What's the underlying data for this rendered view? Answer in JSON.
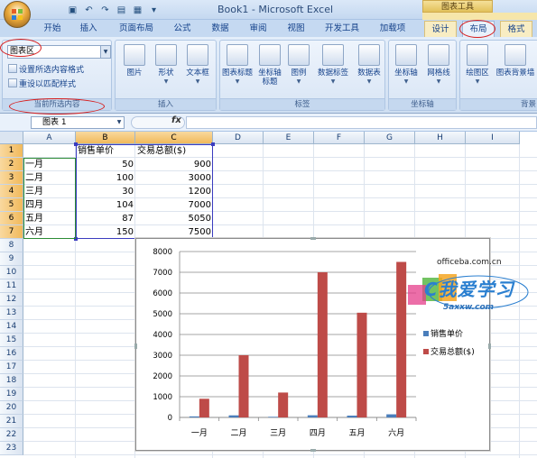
{
  "app": {
    "window_title": "Book1 - Microsoft Excel",
    "context_group": "图表工具"
  },
  "quick_access": {
    "icons": [
      "save-icon",
      "undo-icon",
      "redo-icon",
      "open-icon",
      "print-preview-icon",
      "customize-icon"
    ]
  },
  "tabs": [
    {
      "label": "开始"
    },
    {
      "label": "插入"
    },
    {
      "label": "页面布局"
    },
    {
      "label": "公式"
    },
    {
      "label": "数据"
    },
    {
      "label": "审阅"
    },
    {
      "label": "视图"
    },
    {
      "label": "开发工具"
    },
    {
      "label": "加载项"
    },
    {
      "label": "设计"
    },
    {
      "label": "布局"
    },
    {
      "label": "格式"
    }
  ],
  "active_tab": "布局",
  "ribbon": {
    "current_selection": {
      "combo_value": "图表区",
      "cmd_format": "设置所选内容格式",
      "cmd_reset": "重设以匹配样式",
      "label": "当前所选内容"
    },
    "insert_group": {
      "label": "插入",
      "buttons": [
        "图片",
        "形状",
        "文本框"
      ]
    },
    "labels_group": {
      "label": "标签",
      "buttons": [
        "图表标题",
        "坐标轴标题",
        "图例",
        "数据标签",
        "模拟运算表"
      ],
      "visible_labels": [
        "图表标题",
        "坐标轴\n标题",
        "图例",
        "数据标签",
        "数据表"
      ]
    },
    "axes_group": {
      "label": "坐标轴",
      "buttons": [
        "坐标轴",
        "网格线"
      ]
    },
    "background_group": {
      "label": "背景",
      "buttons": [
        "绘图区",
        "图表背景墙"
      ]
    }
  },
  "formula_bar": {
    "name_box": "图表 1",
    "fx": "fx",
    "formula": ""
  },
  "sheet": {
    "columns": [
      "A",
      "B",
      "C",
      "D",
      "E",
      "F",
      "G",
      "H",
      "I"
    ],
    "rows": [
      "1",
      "2",
      "3",
      "4",
      "5",
      "6",
      "7",
      "8",
      "9",
      "10",
      "11",
      "12",
      "13",
      "14",
      "15",
      "16",
      "17",
      "18",
      "19",
      "20",
      "21",
      "22",
      "23"
    ],
    "header": {
      "B": "销售单价",
      "C": "交易总额($)"
    },
    "data": [
      {
        "month": "一月",
        "price": "50",
        "total": "900"
      },
      {
        "month": "二月",
        "price": "100",
        "total": "3000"
      },
      {
        "month": "三月",
        "price": "30",
        "total": "1200"
      },
      {
        "month": "四月",
        "price": "104",
        "total": "7000"
      },
      {
        "month": "五月",
        "price": "87",
        "total": "5050"
      },
      {
        "month": "六月",
        "price": "150",
        "total": "7500"
      }
    ]
  },
  "chart_data": {
    "type": "bar",
    "categories": [
      "一月",
      "二月",
      "三月",
      "四月",
      "五月",
      "六月"
    ],
    "series": [
      {
        "name": "销售单价",
        "values": [
          50,
          100,
          30,
          104,
          87,
          150
        ],
        "color": "#4a7ebb"
      },
      {
        "name": "交易总额($)",
        "values": [
          900,
          3000,
          1200,
          7000,
          5050,
          7500
        ],
        "color": "#be4b48"
      }
    ],
    "ylim": [
      0,
      8000
    ],
    "yticks": [
      0,
      1000,
      2000,
      3000,
      4000,
      5000,
      6000,
      7000,
      8000
    ],
    "grid": true,
    "legend_position": "right"
  },
  "watermark": {
    "url": "officeba.com.cn",
    "logo": "C我爱学习",
    "site": "5axxw.com"
  },
  "colors": {
    "ribbon_bg": "#dbe7f6",
    "context_tab": "#f6e6aa",
    "highlight_oval": "#d71d1d",
    "series1": "#4a7ebb",
    "series2": "#be4b48"
  }
}
